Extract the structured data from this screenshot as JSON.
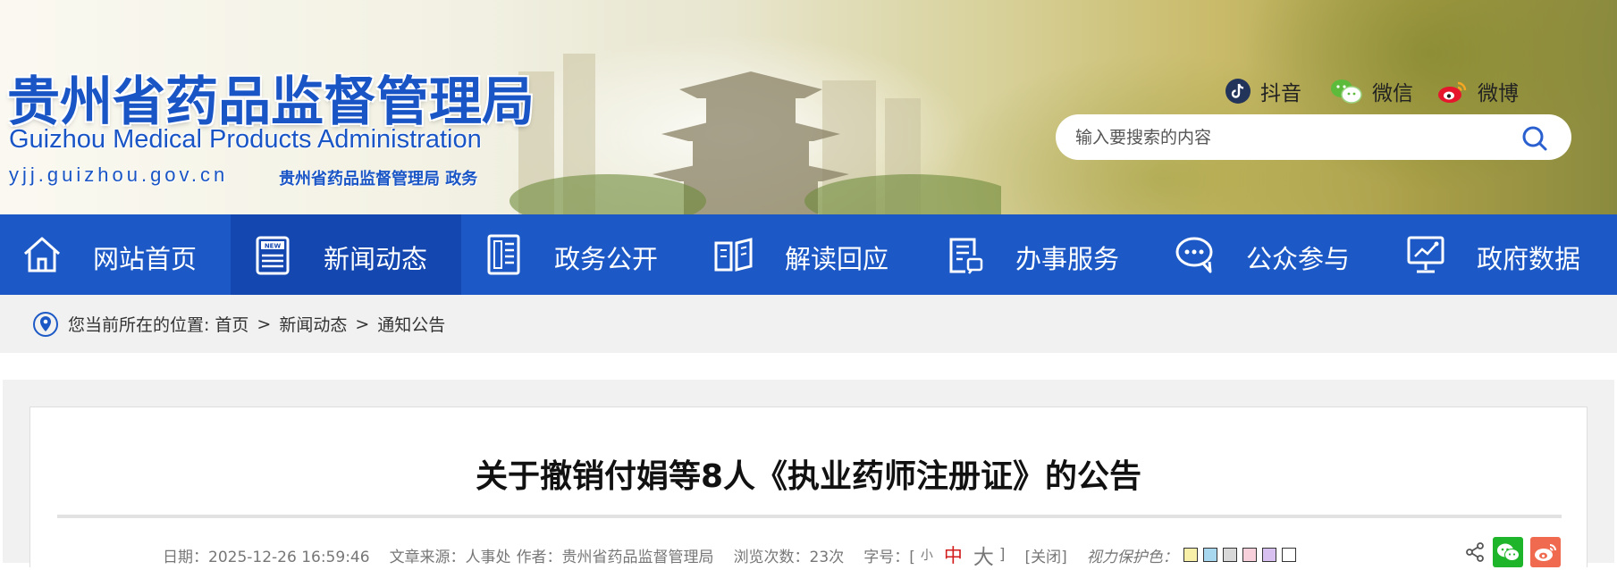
{
  "header": {
    "logo_cn": "贵州省药品监督管理局",
    "logo_en": "Guizhou Medical Products Administration",
    "logo_url": "yjj.guizhou.gov.cn",
    "logo_sub": "贵州省药品监督管理局 政务",
    "social": [
      {
        "label": "抖音",
        "icon": "douyin-icon"
      },
      {
        "label": "微信",
        "icon": "wechat-icon"
      },
      {
        "label": "微博",
        "icon": "weibo-icon"
      }
    ],
    "search_placeholder": "输入要搜索的内容"
  },
  "nav": {
    "items": [
      {
        "label": "网站首页",
        "icon": "home-icon"
      },
      {
        "label": "新闻动态",
        "icon": "news-icon",
        "active": true
      },
      {
        "label": "政务公开",
        "icon": "document-icon"
      },
      {
        "label": "解读回应",
        "icon": "open-book-icon"
      },
      {
        "label": "办事服务",
        "icon": "service-form-icon"
      },
      {
        "label": "公众参与",
        "icon": "chat-bubble-icon"
      },
      {
        "label": "政府数据",
        "icon": "monitor-chart-icon"
      }
    ],
    "bg_color": "#1d59c6",
    "active_color": "#1447b0"
  },
  "breadcrumb": {
    "prefix": "您当前所在的位置:",
    "items": [
      "首页",
      "新闻动态",
      "通知公告"
    ],
    "separator": ">"
  },
  "article": {
    "title": "关于撤销付娟等8人《执业药师注册证》的公告",
    "date": "日期：2025-12-26 16:59:46",
    "source": "文章来源：人事处",
    "author": "作者：贵州省药品监督管理局",
    "views": "浏览次数：23次",
    "font_size_label": "字号：[",
    "font_small": "小",
    "font_mid": "中",
    "font_big": "大",
    "font_close_bracket": "]",
    "close_label": "[关闭]",
    "eye_care_label": "视力保护色：",
    "eye_care_colors": [
      "#f8f0a8",
      "#a8d8f0",
      "#d8d8d8",
      "#f8d0dc",
      "#d8c0f0",
      "#ffffff"
    ]
  }
}
